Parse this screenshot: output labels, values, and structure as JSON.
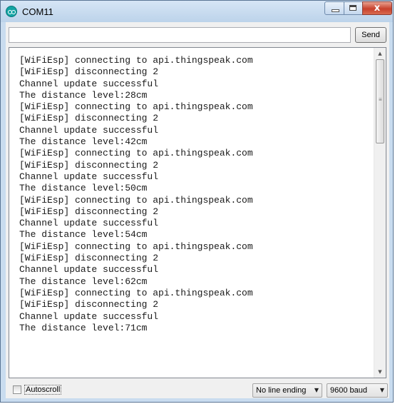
{
  "window": {
    "title": "COM11",
    "close_glyph": "x"
  },
  "toolbar": {
    "send_label": "Send",
    "input_value": ""
  },
  "output": {
    "lines": [
      "[WiFiEsp] connecting to api.thingspeak.com",
      "[WiFiEsp] disconnecting 2",
      "Channel update successful",
      "The distance level:28cm",
      "[WiFiEsp] connecting to api.thingspeak.com",
      "[WiFiEsp] disconnecting 2",
      "Channel update successful",
      "The distance level:42cm",
      "[WiFiEsp] connecting to api.thingspeak.com",
      "[WiFiEsp] disconnecting 2",
      "Channel update successful",
      "The distance level:50cm",
      "[WiFiEsp] connecting to api.thingspeak.com",
      "[WiFiEsp] disconnecting 2",
      "Channel update successful",
      "The distance level:54cm",
      "[WiFiEsp] connecting to api.thingspeak.com",
      "[WiFiEsp] disconnecting 2",
      "Channel update successful",
      "The distance level:62cm",
      "[WiFiEsp] connecting to api.thingspeak.com",
      "[WiFiEsp] disconnecting 2",
      "Channel update successful",
      "The distance level:71cm"
    ]
  },
  "footer": {
    "autoscroll_label": "Autoscroll",
    "autoscroll_checked": false,
    "line_ending": "No line ending",
    "baud_rate": "9600 baud"
  },
  "icons": {
    "app": "arduino-icon",
    "minimize": "minimize-icon",
    "maximize": "maximize-icon",
    "close": "close-icon",
    "scroll_up": "scroll-up-arrow-icon",
    "scroll_down": "scroll-down-arrow-icon",
    "dropdown": "chevron-down-icon"
  },
  "colors": {
    "app_icon": "#12a3a3",
    "close_button": "#c8412c",
    "titlebar": "#c9dcef"
  }
}
